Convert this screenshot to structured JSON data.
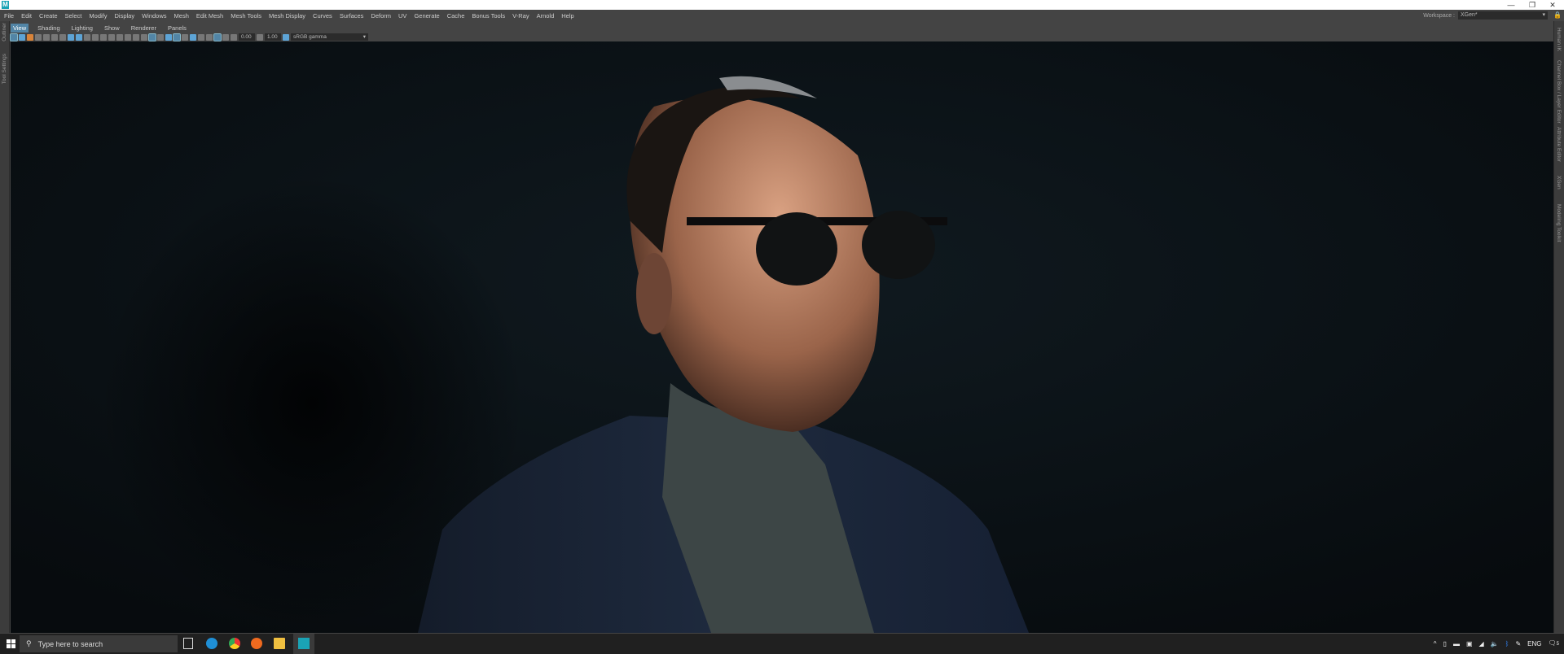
{
  "app": {
    "logo": "M"
  },
  "window_controls": {
    "minimize": "—",
    "restore": "❐",
    "close": "✕"
  },
  "menu": [
    "File",
    "Edit",
    "Create",
    "Select",
    "Modify",
    "Display",
    "Windows",
    "Mesh",
    "Edit Mesh",
    "Mesh Tools",
    "Mesh Display",
    "Curves",
    "Surfaces",
    "Deform",
    "UV",
    "Generate",
    "Cache",
    "Bonus Tools",
    "V-Ray",
    "Arnold",
    "Help"
  ],
  "workspace": {
    "label": "Workspace :",
    "value": "XGen*"
  },
  "left_tabs": [
    "Outliner",
    "Tool Settings"
  ],
  "right_tabs": [
    "Human IK",
    "Channel Box / Layer Editor",
    "Attribute Editor",
    "XGen",
    "Modeling Toolkit"
  ],
  "panel_menu": [
    "View",
    "Shading",
    "Lighting",
    "Show",
    "Renderer",
    "Panels"
  ],
  "toolbar": {
    "exposure": "0.00",
    "gamma": "1.00",
    "color_space": "sRGB gamma"
  },
  "taskbar": {
    "search_placeholder": "Type here to search",
    "language": "ENG",
    "notifications": "5"
  }
}
